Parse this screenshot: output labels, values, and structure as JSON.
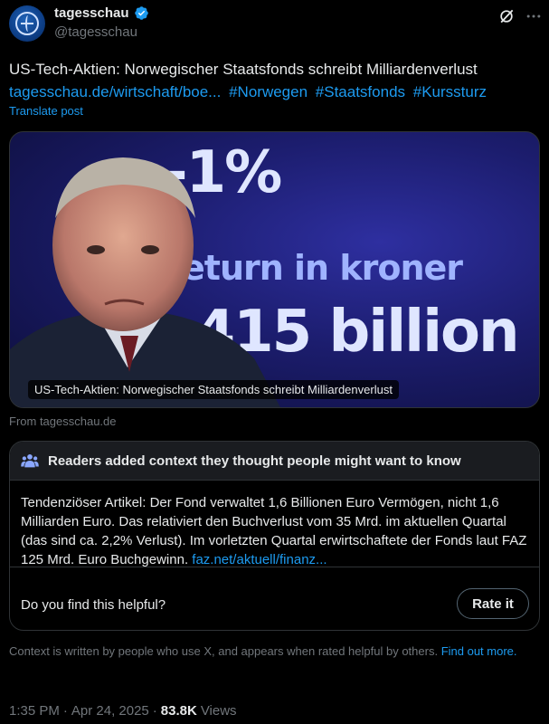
{
  "author": {
    "display_name": "tagesschau",
    "handle": "@tagesschau"
  },
  "post": {
    "text": "US-Tech-Aktien: Norwegischer Staatsfonds schreibt Milliardenverlust",
    "link": "tagesschau.de/wirtschaft/boe...",
    "hashtags": [
      "#Norwegen",
      "#Staatsfonds",
      "#Kurssturz"
    ],
    "translate_label": "Translate post"
  },
  "media": {
    "image_text_line1": "-1%",
    "image_text_line2": "eturn in kroner",
    "image_text_line3": "-415 billion",
    "caption": "US-Tech-Aktien: Norwegischer Staatsfonds schreibt Milliardenverlust",
    "source": "From tagesschau.de"
  },
  "community_note": {
    "header": "Readers added context they thought people might want to know",
    "body": "Tendenziöser Artikel: Der Fond verwaltet 1,6 Billionen Euro Vermögen, nicht 1,6 Milliarden Euro. Das relativiert den Buchverlust vom 35 Mrd. im aktuellen Quartal (das sind ca. 2,2% Verlust). Im vorletzten Quartal erwirtschaftete der Fonds laut FAZ 125 Mrd. Euro Buchgewinn.",
    "link": "faz.net/aktuell/finanz...",
    "helpful_question": "Do you find this helpful?",
    "rate_label": "Rate it"
  },
  "context_text": "Context is written by people who use X, and appears when rated helpful by others.",
  "find_out_more": "Find out more.",
  "meta": {
    "time": "1:35 PM",
    "date": "Apr 24, 2025",
    "views_count": "83.8K",
    "views_label": "Views"
  },
  "colors": {
    "background": "#000000",
    "text": "#e7e9ea",
    "secondary": "#71767b",
    "link": "#1d9bf0",
    "verified": "#1d9bf0",
    "border": "#2f3336"
  },
  "icons": [
    "verified-badge-icon",
    "grok-icon",
    "more-icon",
    "readers-icon"
  ]
}
